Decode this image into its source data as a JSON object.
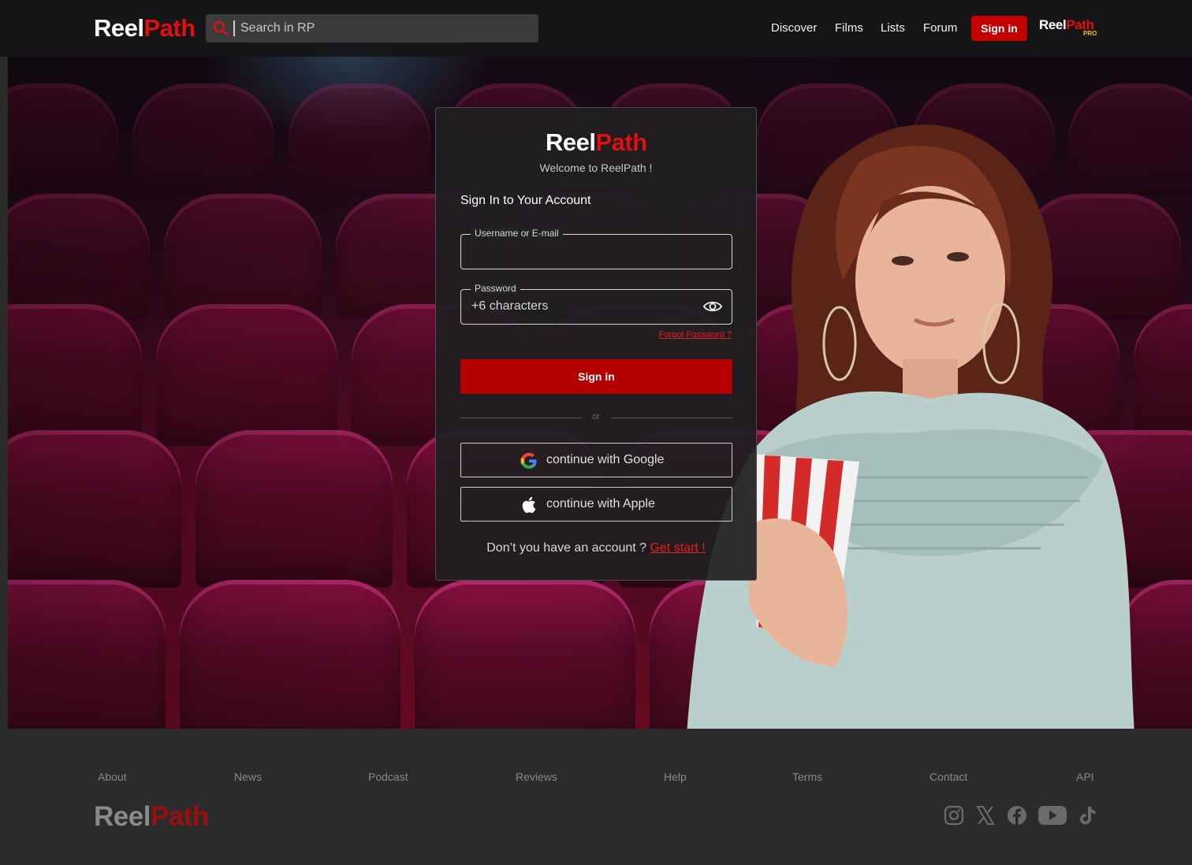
{
  "brand": {
    "reel": "Reel",
    "path": "Path",
    "pro_badge": "PRO"
  },
  "topnav": {
    "search_placeholder": "Search in RP",
    "links": [
      "Discover",
      "Films",
      "Lists",
      "Forum"
    ],
    "signin_label": "Sign in"
  },
  "login": {
    "welcome": "Welcome to ReelPath !",
    "title": "Sign In to Your Account",
    "username_label": "Username or E-mail",
    "username_value": "",
    "password_label": "Password",
    "password_value": "+6 characters",
    "forgot": "Forgot Password ?",
    "signin_button": "Sign in",
    "or": "or",
    "google_button": "continue with Google",
    "apple_button": "continue with Apple",
    "no_account": "Don’t you have an account ?",
    "get_start": "Get start !"
  },
  "footer": {
    "links": [
      "About",
      "News",
      "Podcast",
      "Reviews",
      "Help",
      "Terms",
      "Contact",
      "API"
    ],
    "social_icons": [
      "instagram-icon",
      "x-icon",
      "facebook-icon",
      "youtube-icon",
      "tiktok-icon"
    ]
  },
  "colors": {
    "accent": "#e01010",
    "button_red": "#b40000",
    "nav_bg": "#161618",
    "footer_bg": "#2b2b2b"
  }
}
